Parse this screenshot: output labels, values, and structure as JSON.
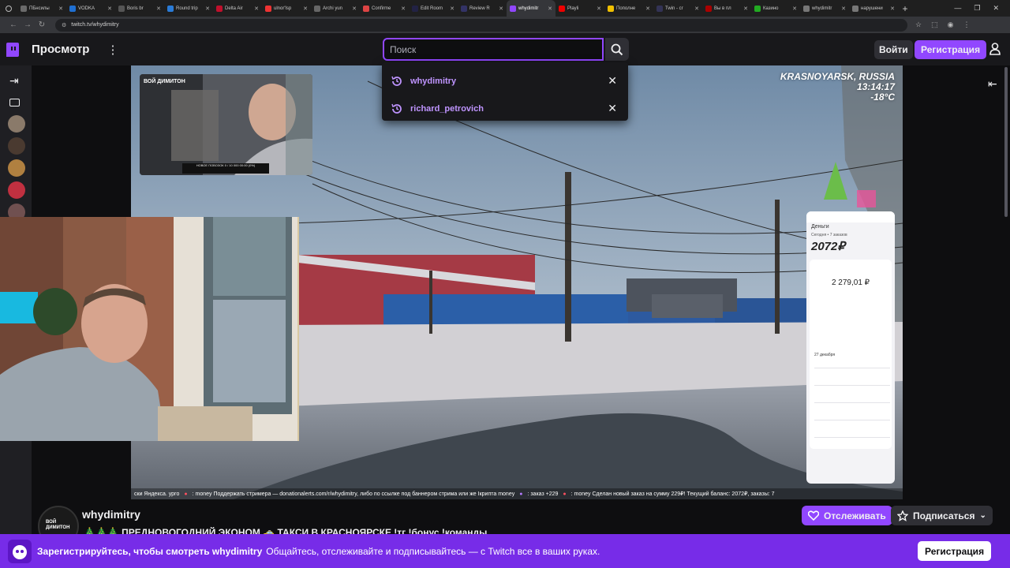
{
  "browser": {
    "tabs": [
      {
        "label": "ПБнсилы",
        "color": "#6a6a6a"
      },
      {
        "label": "VODKA",
        "color": "#1f6fd1"
      },
      {
        "label": "Boris br",
        "color": "#555"
      },
      {
        "label": "Round trip",
        "color": "#2a7bd6"
      },
      {
        "label": "Delta Air",
        "color": "#c0102c"
      },
      {
        "label": "ulnor'lsp",
        "color": "#e33"
      },
      {
        "label": "Archi yun",
        "color": "#666"
      },
      {
        "label": "Confirme",
        "color": "#d44"
      },
      {
        "label": "Edit Room",
        "color": "#224"
      },
      {
        "label": "Review R",
        "color": "#333366"
      },
      {
        "label": "whydimitr",
        "color": "#9147ff",
        "active": true
      },
      {
        "label": "Playli",
        "color": "#e00"
      },
      {
        "label": "Пополне",
        "color": "#f0c000"
      },
      {
        "label": "Twin - cr",
        "color": "#335"
      },
      {
        "label": "Вы в пл",
        "color": "#a00"
      },
      {
        "label": "Казино",
        "color": "#2a2"
      },
      {
        "label": "whydimitr",
        "color": "#777"
      },
      {
        "label": "нарушени",
        "color": "#777"
      }
    ],
    "url": "twitch.tv/whydimitry"
  },
  "nav": {
    "browse": "Просмотр",
    "search_placeholder": "Поиск",
    "login": "Войти",
    "signup": "Регистрация"
  },
  "search_suggestions": [
    {
      "name": "whydimitry"
    },
    {
      "name": "richard_petrovich"
    }
  ],
  "sidebar": {
    "avatars": [
      "#8a7a6a",
      "#4a3a30",
      "#b08040",
      "#c03040",
      "#705050"
    ]
  },
  "player": {
    "location_line1": "KRASNOYARSK, RUSSIA",
    "location_line2": "13:14:17",
    "location_line3": "-18°C",
    "pip_logo": "ВОЙ ДИМИТОН",
    "pip_label": "НОВОЕ ПОВОЗОК 0 / 10 000 00:00 (0%)",
    "phone_money_title": "Деньги",
    "phone_orders": "Сегодня • 7 заказов",
    "phone_money_amount": "2072₽",
    "phone_balance": "2 279,01 ₽",
    "phone_date": "27 декабря",
    "ticker": {
      "part1": "ски Яндекса. урго",
      "part2": ": money Поддержать стримера — donationalerts.com/r/whydimitry, либо по ссылке под баннером стрима или же Ікрипта money",
      "part3": ": заказ +229",
      "part4": ": money Сделан новый заказ на сумму 229₽! Текущий баланс: 2072₽, заказы: 7"
    }
  },
  "channel": {
    "avatar_text": "ВОЙ ДИМИТОН",
    "name": "whydimitry",
    "title": "🎄🎄🎄 ПРЕДНОВОГОДНИЙ ЭКОНОМ 🚕 ТАКСИ В КРАСНОЯРСКЕ !тг !бонус !команды",
    "follow": "Отслеживать",
    "subscribe": "Подписаться"
  },
  "banner": {
    "bold": "Зарегистрируйтесь, чтобы смотреть whydimitry",
    "text": "Общайтесь, отслеживайте и подписывайтесь — с Twitch все в ваших руках.",
    "button": "Регистрация"
  },
  "colors": {
    "accent": "#9147ff",
    "banner": "#772ce8"
  }
}
